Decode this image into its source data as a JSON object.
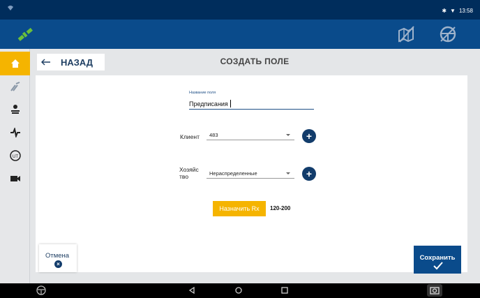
{
  "status_bar": {
    "time": "13:58"
  },
  "header": {
    "back_label": "НАЗАД",
    "title": "СОЗДАТЬ ПОЛЕ"
  },
  "form": {
    "field_name": {
      "label": "Название поля",
      "value": "Предписания"
    },
    "client": {
      "label": "Клиент",
      "value": "483"
    },
    "farm": {
      "label_line1": "Хозяйс",
      "label_line2": "тво",
      "value": "Нераспределенные"
    },
    "rx": {
      "button_label": "Назначить Rx",
      "value": "120-200"
    }
  },
  "footer": {
    "cancel_label": "Отмена",
    "save_label": "Сохранить"
  },
  "colors": {
    "brand_blue": "#0a4b8b",
    "accent_yellow": "#f5b400",
    "dark_blue": "#123c6b"
  },
  "icons": [
    "satellite-icon",
    "field-map-icon",
    "steering-wheel-icon",
    "home-icon",
    "guidance-icon",
    "implement-icon",
    "pulse-icon",
    "ut-icon",
    "camera-icon"
  ]
}
